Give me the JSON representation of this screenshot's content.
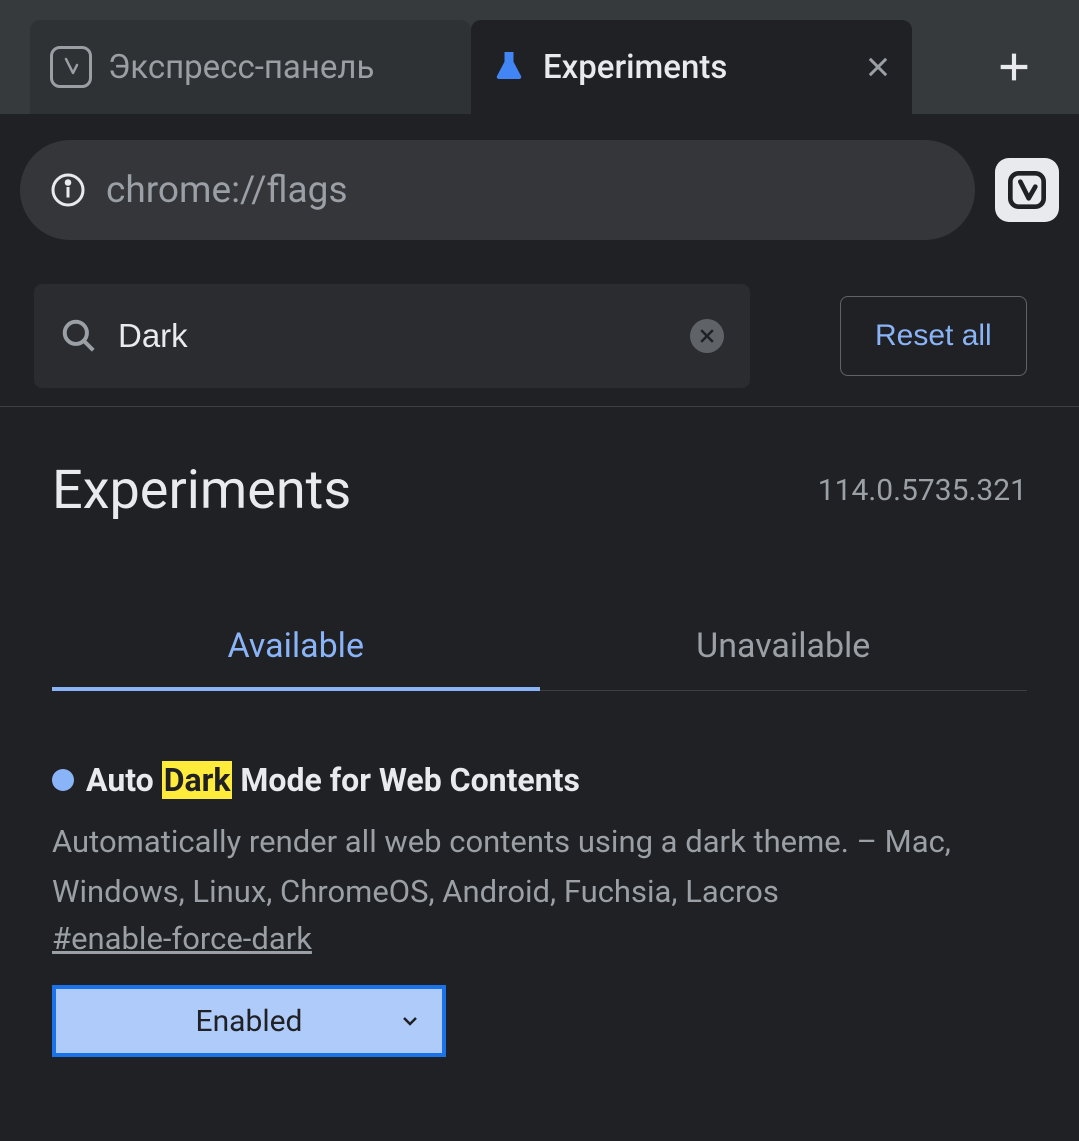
{
  "tabs": {
    "inactive_label": "Экспресс-панель",
    "active_label": "Experiments"
  },
  "url": "chrome://flags",
  "search": {
    "value": "Dark"
  },
  "reset_all_label": "Reset all",
  "page": {
    "heading": "Experiments",
    "version": "114.0.5735.321"
  },
  "nav_tabs": {
    "available": "Available",
    "unavailable": "Unavailable"
  },
  "flag": {
    "title_before": "Auto ",
    "title_highlight": "Dark",
    "title_after": " Mode for Web Contents",
    "description": "Automatically render all web contents using a dark theme. – Mac, Windows, Linux, ChromeOS, Android, Fuchsia, Lacros",
    "anchor": "#enable-force-dark",
    "select_value": "Enabled"
  }
}
